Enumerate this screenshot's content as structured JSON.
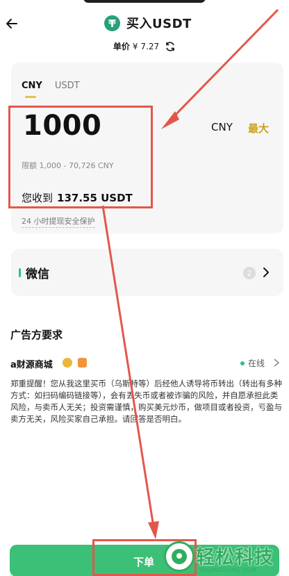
{
  "header": {
    "title": "买入USDT",
    "coin_icon": "tether-icon",
    "back_icon": "back-arrow-icon"
  },
  "price": {
    "label": "单价",
    "value": "¥ 7.27",
    "refresh_icon": "refresh-icon"
  },
  "order_card": {
    "tabs": [
      {
        "label": "CNY",
        "active": true
      },
      {
        "label": "USDT",
        "active": false
      }
    ],
    "amount": "1000",
    "unit": "CNY",
    "max_label": "最大",
    "limit_text": "限额 1,000 - 70,726 CNY",
    "receive_label": "您收到",
    "receive_value": "137.55 USDT",
    "protection_text": "24 小时提现安全保护"
  },
  "payment": {
    "method": "微信",
    "count": "2",
    "chevron_icon": "chevron-right-icon"
  },
  "advertiser": {
    "section_title": "广告方要求",
    "merchant_name": "a财源商城",
    "status": "在线",
    "notice": "郑重提醒！您从我这里买币（乌斯特等）后经他人诱导将币转出（转出有多种方式：如扫码编码链接等），会有丢失币或者被诈骗的风险，并自愿承担此类风险，与卖币人无关；投资需谨慎，购买美元炒币，做项目或者投资，亏盈与卖方无关，风险买家自己承担。请回答是否明白。"
  },
  "footer": {
    "buy_label": "下单"
  },
  "watermark": {
    "text": "轻松科技",
    "sub": "YNQINGSONG.COM"
  },
  "colors": {
    "accent_gold": "#caa11f",
    "buy_green": "#3cbf76",
    "annotation_red": "#e2574a",
    "tether_green": "#26a17b"
  }
}
